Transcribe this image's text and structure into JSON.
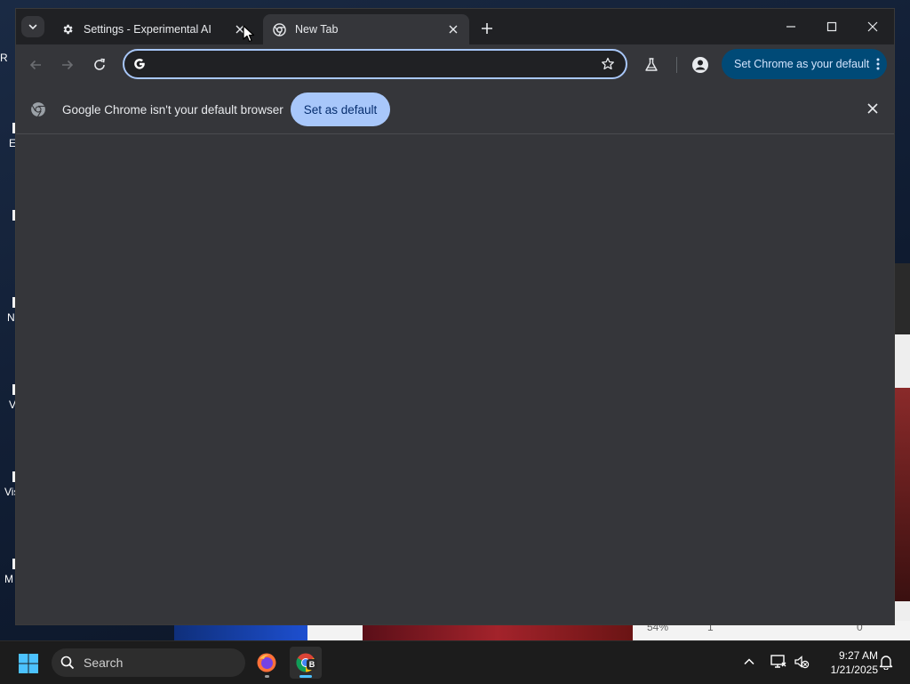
{
  "browser": {
    "tabs": [
      {
        "title": "Settings - Experimental AI",
        "icon": "gear-icon"
      },
      {
        "title": "New Tab",
        "icon": "chrome-icon"
      }
    ],
    "omnibox": {
      "value": "",
      "placeholder": ""
    },
    "set_chrome_default_label": "Set Chrome as your default",
    "infobar": {
      "message": "Google Chrome isn't your default browser",
      "action_label": "Set as default"
    }
  },
  "desktop": {
    "icon_labels": [
      "R",
      "E",
      "N",
      "V",
      "Vis",
      "M"
    ],
    "background_stats": [
      "54%",
      "1",
      "0"
    ]
  },
  "taskbar": {
    "search_label": "Search",
    "apps": [
      {
        "name": "Firefox",
        "icon": "firefox-icon"
      },
      {
        "name": "Chrome",
        "icon": "chrome-icon",
        "badge": "B"
      }
    ],
    "clock": {
      "time": "9:27 AM",
      "date": "1/21/2025"
    }
  },
  "colors": {
    "accent": "#a8c7fa",
    "promo_button": "#004a77",
    "tab_active": "#35363a",
    "window_frame": "#202124"
  }
}
